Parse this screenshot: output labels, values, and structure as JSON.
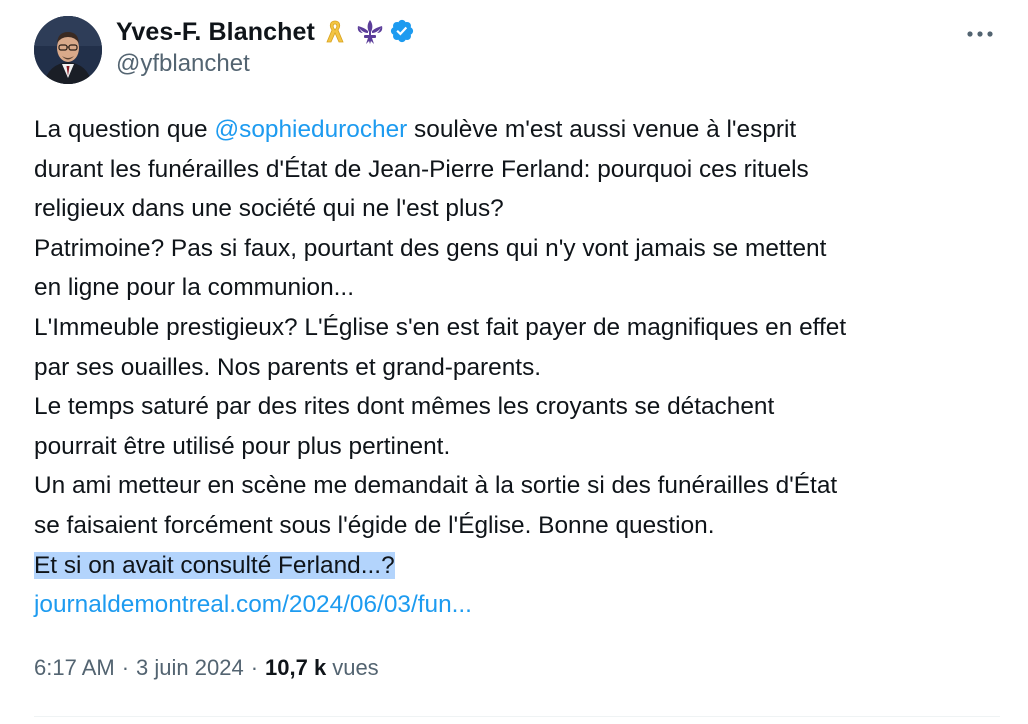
{
  "author": {
    "display_name": "Yves-F. Blanchet",
    "handle": "@yfblanchet",
    "badges": [
      "yellow-ribbon-icon",
      "fleur-de-lis-icon",
      "verified-badge-icon"
    ],
    "verified_color": "#1d9bf0"
  },
  "tweet": {
    "line1_pre": "La question que ",
    "mention": "@sophiedurocher",
    "line1_post": " soulève m'est aussi venue à l'esprit",
    "lines": [
      "durant les funérailles d'État de Jean-Pierre Ferland: pourquoi ces rituels",
      "religieux dans une société qui ne l'est plus?",
      "Patrimoine? Pas si faux, pourtant des gens qui n'y vont jamais se mettent",
      "en ligne pour la communion...",
      "L'Immeuble prestigieux? L'Église s'en est fait payer de magnifiques en effet",
      "par ses ouailles. Nos parents et grand-parents.",
      "Le temps saturé par des rites dont mêmes les croyants se détachent",
      "pourrait être utilisé pour plus pertinent.",
      "Un ami metteur en scène me demandait à la sortie si des funérailles d'État",
      "se faisaient forcément sous l'égide de l'Église. Bonne question."
    ],
    "highlighted_line": "Et si on avait consulté Ferland...?",
    "link_text": "journaldemontreal.com/2024/06/03/fun..."
  },
  "meta": {
    "time": "6:17 AM",
    "separator": "·",
    "date": "3 juin 2024",
    "views_count": "10,7 k",
    "views_label": "vues"
  },
  "colors": {
    "accent": "#1d9bf0",
    "text": "#0f1419",
    "secondary": "#536471",
    "highlight": "#b3d4fc"
  }
}
